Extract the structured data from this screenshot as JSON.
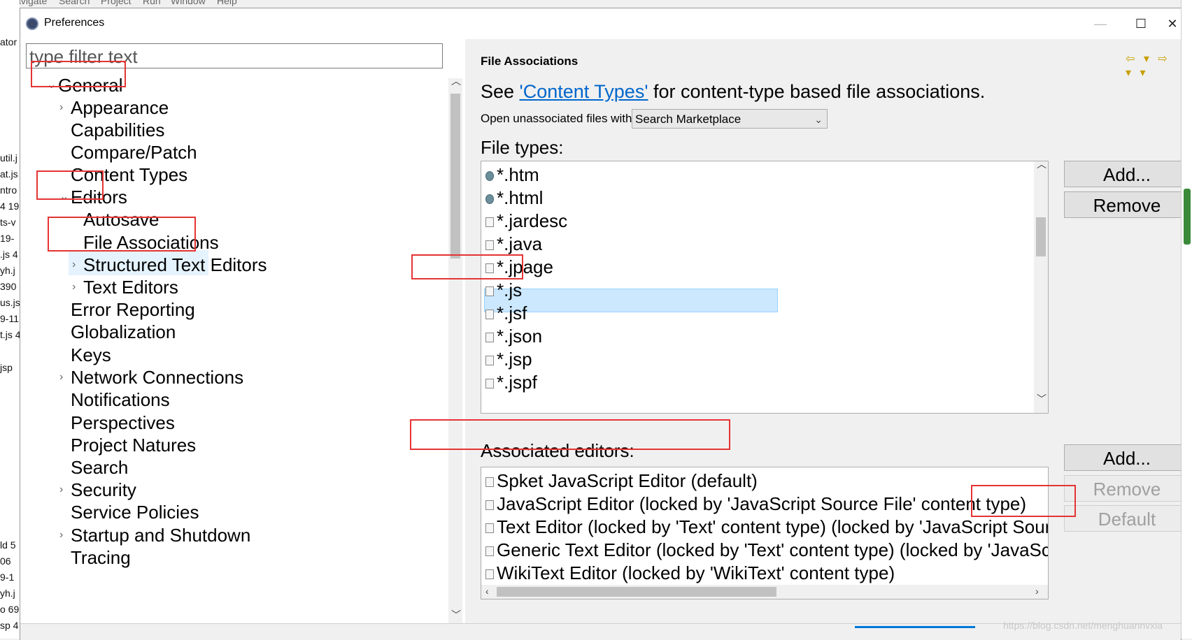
{
  "background": {
    "menu": [
      "Navigate",
      "Search",
      "Project",
      "Run",
      "Window",
      "Help"
    ],
    "left_fragments": [
      "ator",
      "util.j",
      "at.js",
      "ntro",
      "4  19",
      "ts-v",
      "19-",
      ".js 4",
      "yh.j",
      "390",
      "us.js",
      "9-11",
      "t.js 4",
      "jsp",
      "ld 5",
      "06",
      "9-1",
      "yh.j",
      "o 69",
      "sp 4"
    ]
  },
  "window": {
    "title": "Preferences",
    "controls": [
      "—",
      "☐",
      "✕"
    ]
  },
  "filter": {
    "placeholder": "type filter text"
  },
  "tree": {
    "items": [
      {
        "label": "General",
        "twisty": "⌄"
      },
      {
        "label": "Appearance",
        "twisty": "›"
      },
      {
        "label": "Capabilities",
        "twisty": ""
      },
      {
        "label": "Compare/Patch",
        "twisty": ""
      },
      {
        "label": "Content Types",
        "twisty": ""
      },
      {
        "label": "Editors",
        "twisty": "⌄"
      },
      {
        "label": "Autosave",
        "twisty": ""
      },
      {
        "label": "File Associations",
        "twisty": ""
      },
      {
        "label": "Structured Text Editors",
        "twisty": "›"
      },
      {
        "label": "Text Editors",
        "twisty": "›"
      },
      {
        "label": "Error Reporting",
        "twisty": ""
      },
      {
        "label": "Globalization",
        "twisty": ""
      },
      {
        "label": "Keys",
        "twisty": ""
      },
      {
        "label": "Network Connections",
        "twisty": "›"
      },
      {
        "label": "Notifications",
        "twisty": ""
      },
      {
        "label": "Perspectives",
        "twisty": ""
      },
      {
        "label": "Project Natures",
        "twisty": ""
      },
      {
        "label": "Search",
        "twisty": ""
      },
      {
        "label": "Security",
        "twisty": "›"
      },
      {
        "label": "Service Policies",
        "twisty": ""
      },
      {
        "label": "Startup and Shutdown",
        "twisty": "›"
      },
      {
        "label": "Tracing",
        "twisty": ""
      }
    ]
  },
  "page": {
    "title": "File Associations",
    "nav": "⇦ ▾  ⇨ ▾  ▾",
    "see_prefix": "See ",
    "see_link": "'Content Types'",
    "see_suffix": " for content-type based file associations.",
    "open_label": "Open unassociated files with:",
    "open_value": "Search Marketplace",
    "file_types_label": "File types:",
    "file_types": [
      "*.htm",
      "*.html",
      "*.jardesc",
      "*.java",
      "*.jpage",
      "*.js",
      "*.jsf",
      "*.json",
      "*.jsp",
      "*.jspf"
    ],
    "selected_file_type": "*.js",
    "ft_buttons": {
      "add": "Add...",
      "remove": "Remove"
    },
    "assoc_label": "Associated editors:",
    "editors": [
      "Spket JavaScript Editor (default)",
      "JavaScript Editor (locked by 'JavaScript Source File' content type)",
      "Text Editor (locked by 'Text' content type) (locked by 'JavaScript Sour",
      "Generic Text Editor (locked by 'Text' content type) (locked by 'JavaScr",
      "WikiText Editor (locked by 'WikiText' content type)"
    ],
    "ed_buttons": {
      "add": "Add...",
      "remove": "Remove",
      "default": "Default"
    }
  },
  "watermark": "https://blog.csdn.net/menghuannvxia",
  "colors": {
    "annotation": "#e53333",
    "selection": "#cce8ff",
    "link": "#0066cc"
  }
}
